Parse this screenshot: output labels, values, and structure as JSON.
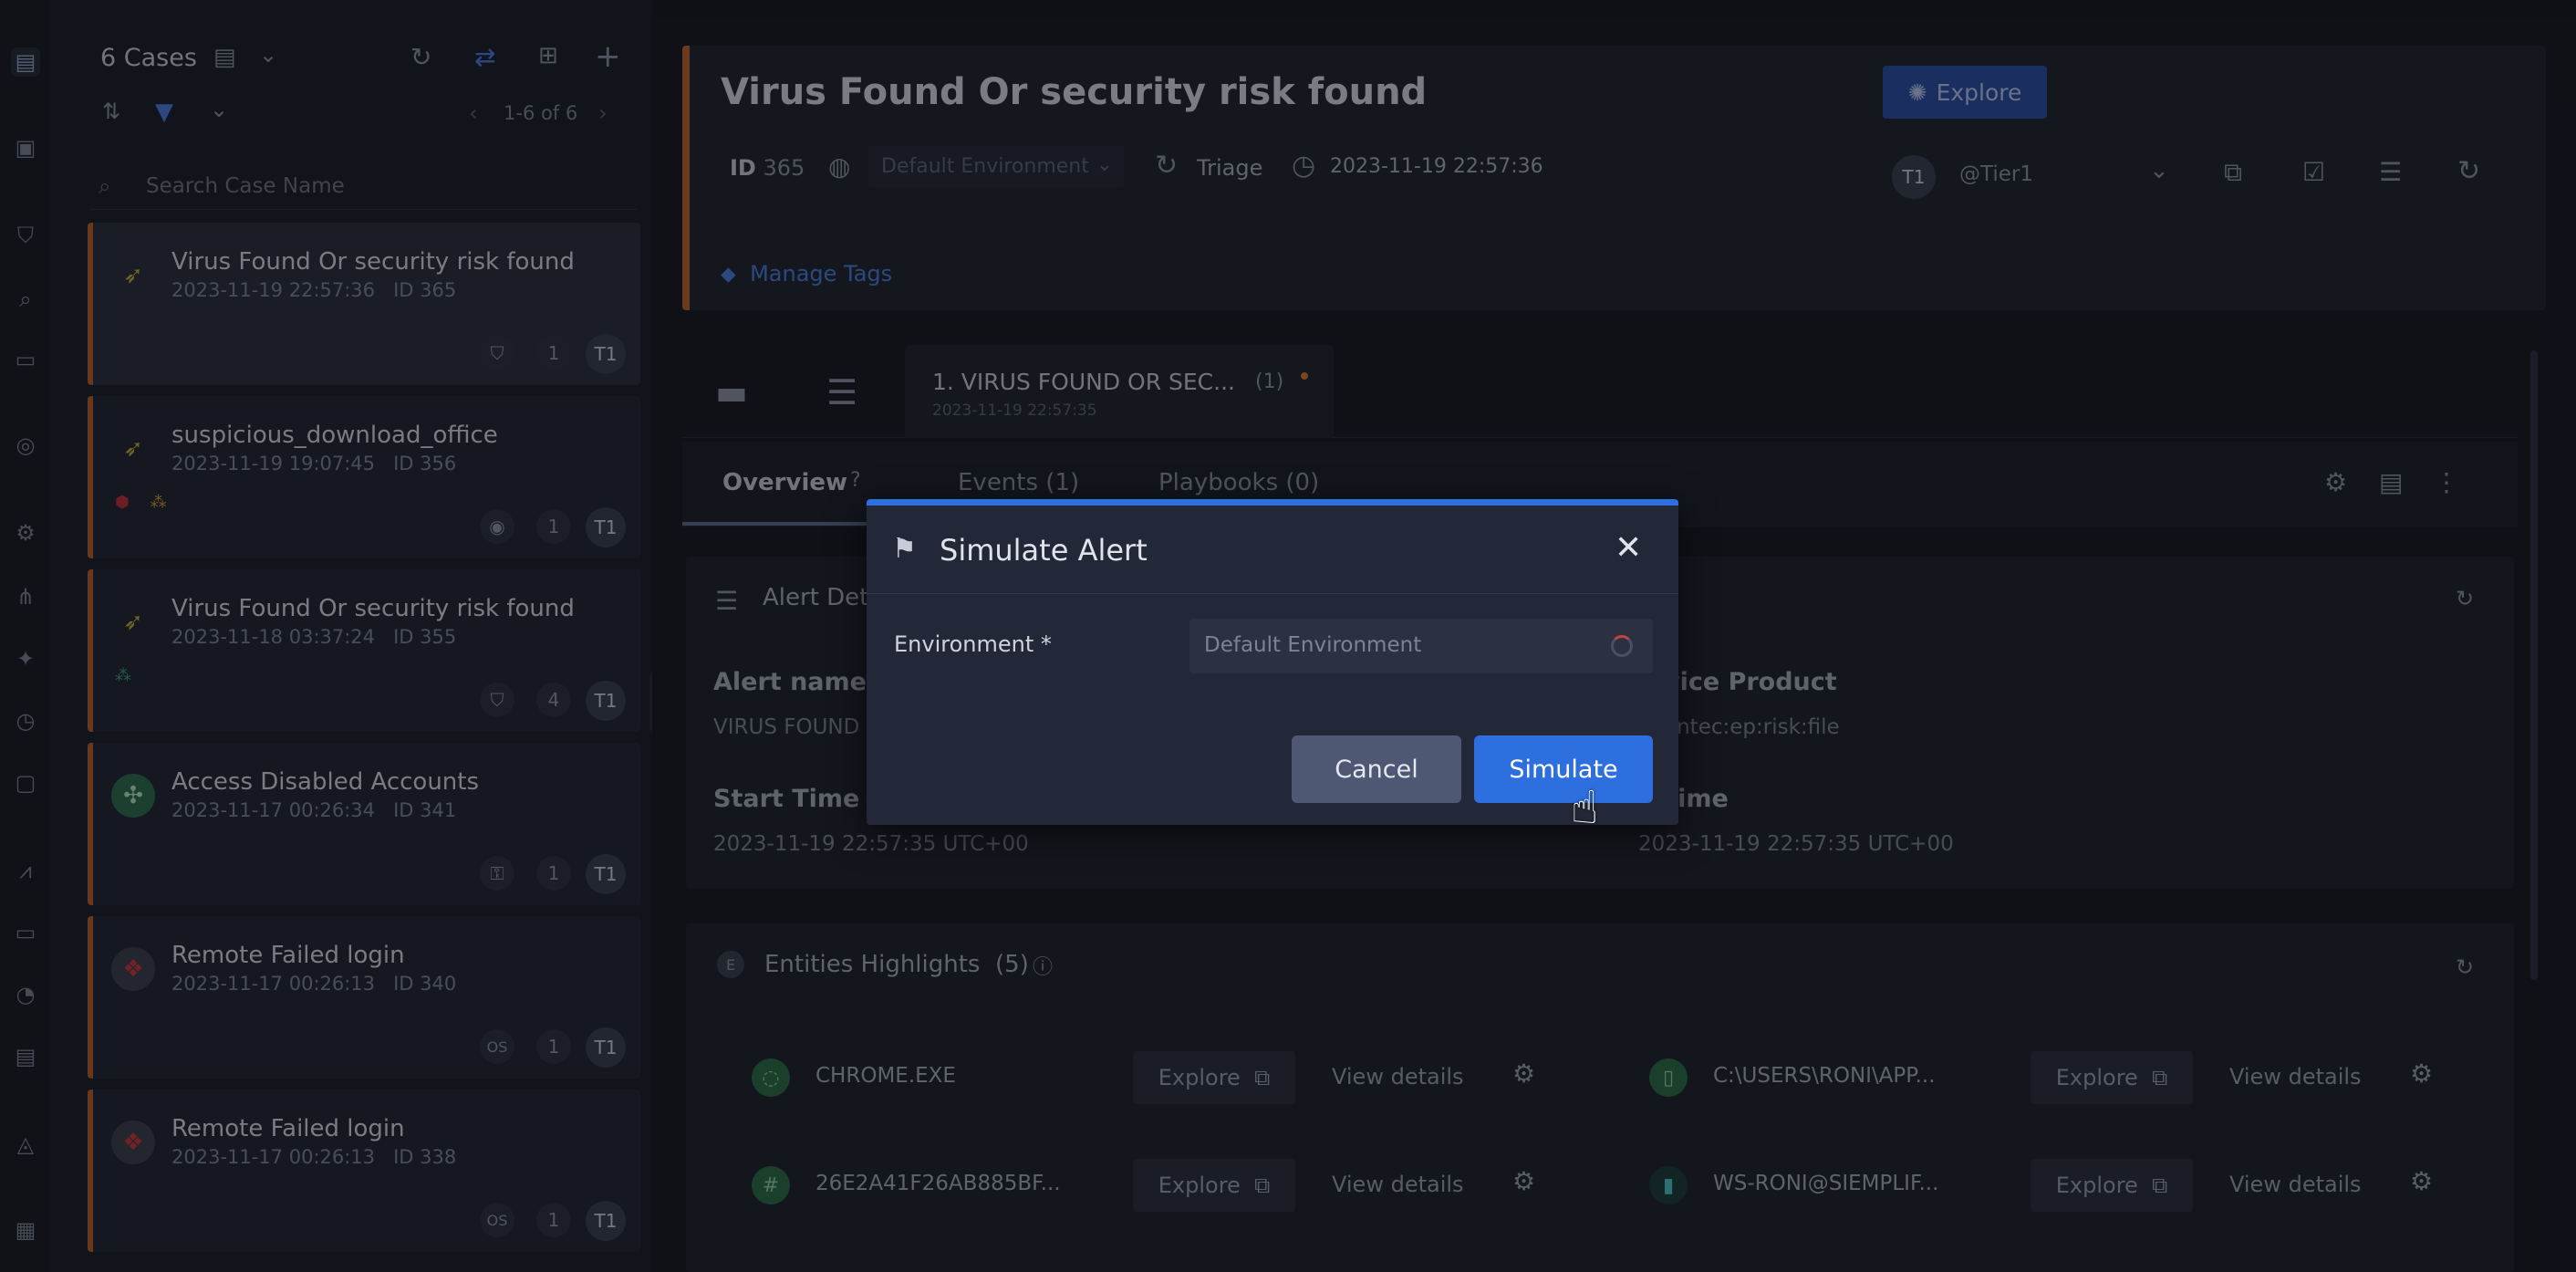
{
  "cases_panel": {
    "count_label": "6 Cases",
    "pagination": "1-6 of 6",
    "search_placeholder": "Search Case Name",
    "cases": [
      {
        "title": "Virus Found Or security risk found",
        "datetime": "2023-11-19 22:57:36",
        "id_label": "ID 365",
        "count": "1",
        "badge": "T1"
      },
      {
        "title": "suspicious_download_office",
        "datetime": "2023-11-19 19:07:45",
        "id_label": "ID 356",
        "count": "1",
        "badge": "T1"
      },
      {
        "title": "Virus Found Or security risk found",
        "datetime": "2023-11-18 03:37:24",
        "id_label": "ID 355",
        "count": "4",
        "badge": "T1"
      },
      {
        "title": "Access Disabled Accounts",
        "datetime": "2023-11-17 00:26:34",
        "id_label": "ID 341",
        "count": "1",
        "badge": "T1"
      },
      {
        "title": "Remote Failed login",
        "datetime": "2023-11-17 00:26:13",
        "id_label": "ID 340",
        "count": "1",
        "badge": "T1",
        "os": "OS"
      },
      {
        "title": "Remote Failed login",
        "datetime": "2023-11-17 00:26:13",
        "id_label": "ID 338",
        "count": "1",
        "badge": "T1",
        "os": "OS"
      }
    ]
  },
  "case_header": {
    "title": "Virus Found Or security risk found",
    "id_prefix": "ID",
    "id_value": "365",
    "environment": "Default Environment",
    "stage": "Triage",
    "datetime": "2023-11-19 22:57:36",
    "assignee_badge": "T1",
    "assignee": "@Tier1",
    "explore_label": "Explore",
    "manage_tags": "Manage Tags"
  },
  "alert_tab": {
    "title": "1. VIRUS FOUND OR SEC...",
    "count": "(1)",
    "datetime": "2023-11-19 22:57:35"
  },
  "subtabs": {
    "overview": "Overview",
    "events": "Events (1)",
    "playbooks": "Playbooks (0)"
  },
  "alert_details": {
    "section_title": "Alert Det",
    "alert_name_label": "Alert name",
    "alert_name_value": "VIRUS FOUND C",
    "device_product_label": "vice Product",
    "device_product_value": "antec:ep:risk:file",
    "start_time_label": "Start Time",
    "start_time_value": "2023-11-19 22:57:35 UTC+00",
    "end_time_label": "d Time",
    "end_time_value": "2023-11-19 22:57:35 UTC+00"
  },
  "entities": {
    "title": "Entities Highlights",
    "count": "(5)",
    "explore_label": "Explore",
    "view_details_label": "View details",
    "items": [
      {
        "name": "CHROME.EXE"
      },
      {
        "name": "C:\\USERS\\RONI\\APP..."
      },
      {
        "name": "26E2A41F26AB885BF..."
      },
      {
        "name": "WS-RONI@SIEMPLIF..."
      }
    ]
  },
  "modal": {
    "title": "Simulate Alert",
    "env_label": "Environment *",
    "env_value": "Default Environment",
    "cancel_label": "Cancel",
    "simulate_label": "Simulate"
  },
  "colors": {
    "accent": "#2e6fe0",
    "case_stripe": "#c0632b",
    "explore_button": "#2a4fa6"
  }
}
